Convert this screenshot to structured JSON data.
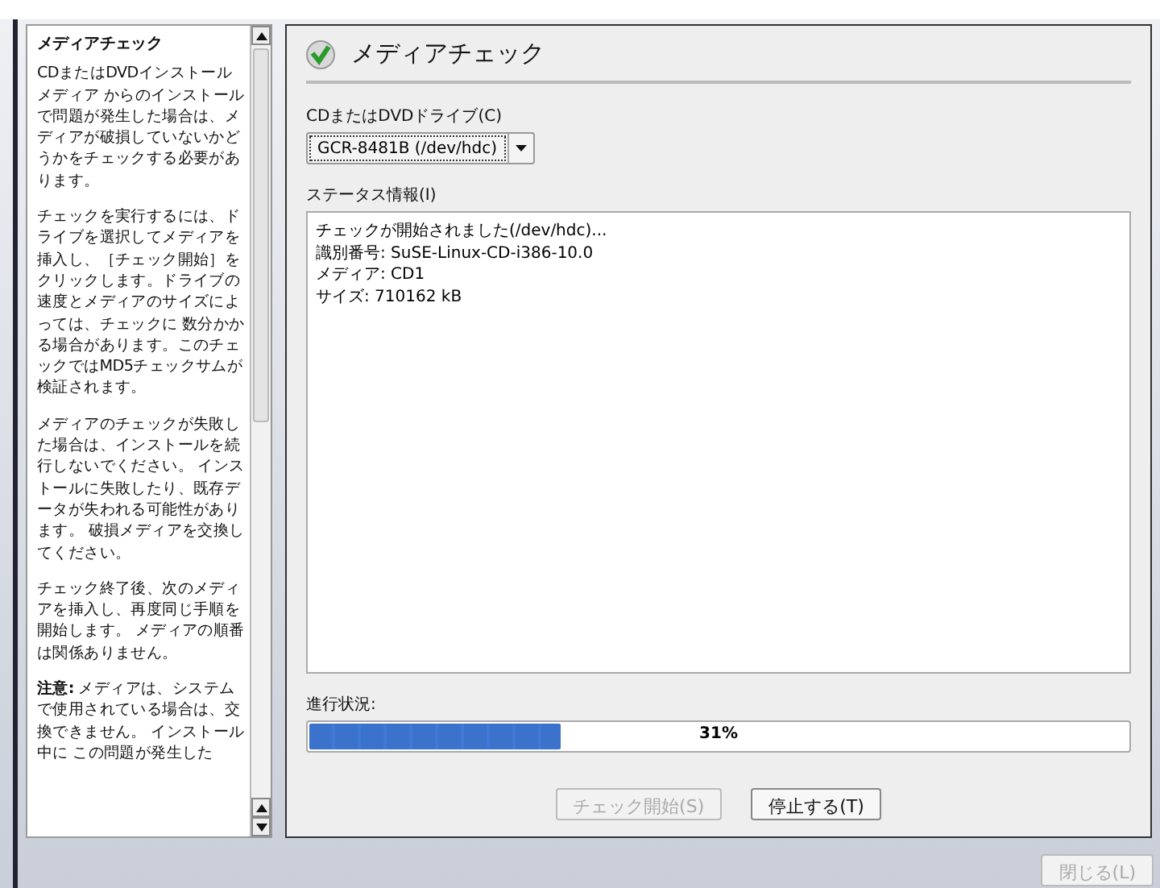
{
  "help": {
    "title": "メディアチェック",
    "paragraphs": [
      "CDまたはDVDインストールメディア からのインストールで問題が発生した場合は、メディアが破損していないかどうかをチェックする必要があります。",
      "チェックを実行するには、ドライブを選択してメディアを挿入し、［チェック開始］をクリックします。ドライブの速度とメディアのサイズによっては、チェックに 数分かかる場合があります。このチェックではMD5チェックサムが検証されます。",
      "メディアのチェックが失敗した場合は、インストールを続行しないでください。 インストールに失敗したり、既存データが失われる可能性があります。 破損メディアを交換してください。",
      "チェック終了後、次のメディアを挿入し、再度同じ手順を開始します。 メディアの順番は関係ありません。",
      "**注意:** メディアは、システムで使用されている場合は、交換できません。 インストール中に この問題が発生した"
    ]
  },
  "dialog": {
    "title": "メディアチェック",
    "drive_label": "CDまたはDVDドライブ(C)",
    "drive_value": "GCR-8481B (/dev/hdc)",
    "status_label": "ステータス情報(I)",
    "status_lines": [
      "チェックが開始されました(/dev/hdc)...",
      "識別番号: SuSE-Linux-CD-i386-10.0",
      "メディア: CD1",
      "サイズ: 710162 kB"
    ],
    "progress_label": "進行状況:",
    "progress": {
      "level": 0.31,
      "text": "31%"
    },
    "buttons": [
      {
        "label": "チェック開始(S)",
        "disabled": true
      },
      {
        "label": "停止する(T)",
        "disabled": false
      }
    ]
  },
  "close_button": {
    "label": "閉じる(L)",
    "disabled": true
  }
}
